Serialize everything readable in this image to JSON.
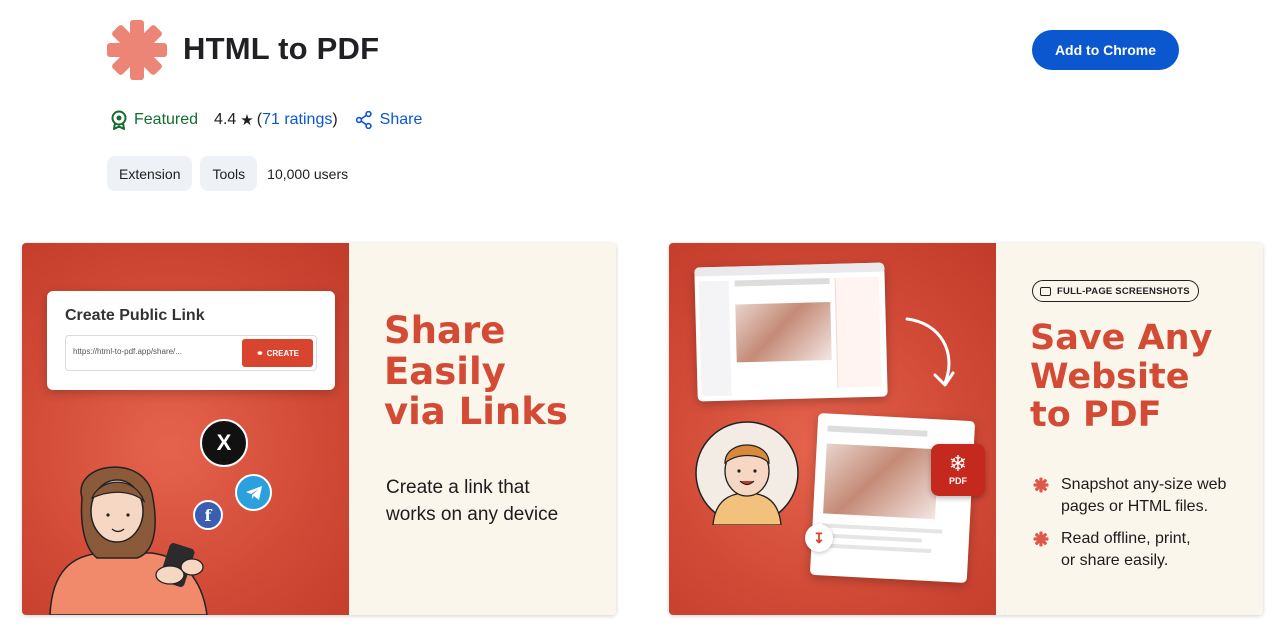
{
  "header": {
    "title": "HTML to PDF",
    "add_button_label": "Add to Chrome",
    "logo_icon": "asterisk-logo-icon",
    "accent_color": "#0b57d0"
  },
  "meta": {
    "featured_label": "Featured",
    "rating_value": "4.4",
    "rating_link": "71 ratings",
    "share_label": "Share"
  },
  "chips": {
    "type": "Extension",
    "category": "Tools",
    "users": "10,000 users"
  },
  "promo1": {
    "card_title": "Create Public Link",
    "url_text": "https://html-to-pdf.app/share/...",
    "create_label": "CREATE",
    "headline_line1": "Share",
    "headline_line2": "Easily",
    "headline_line3": "via Links",
    "sub_line1": "Create a link that",
    "sub_line2": "works on any device",
    "social_x": "X",
    "social_fb": "f"
  },
  "promo2": {
    "badge": "FULL-PAGE SCREENSHOTS",
    "headline_line1": "Save Any",
    "headline_line2": "Website",
    "headline_line3": "to PDF",
    "bullet1_line1": "Snapshot any-size web",
    "bullet1_line2": "pages or HTML files.",
    "bullet2_line1": "Read offline, print,",
    "bullet2_line2": "or share easily.",
    "pdf_label": "PDF"
  }
}
